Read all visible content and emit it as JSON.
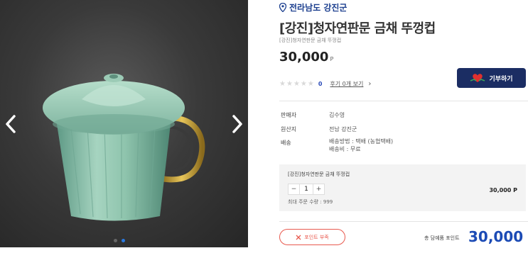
{
  "region": {
    "label": "전라남도 강진군",
    "icon": "location-pin-icon"
  },
  "product": {
    "title": "[강진]청자연판문 금채 뚜껑컵",
    "subtitle": "[강진]청자연판문 금채 뚜껑컵",
    "price": "30,000",
    "currency": "P"
  },
  "rating": {
    "stars": 0,
    "max_stars": 5,
    "count": "0",
    "review_link": "후기 0개 보기"
  },
  "donate_button": {
    "label": "기부하기",
    "icon": "heart-hand-icon"
  },
  "info": [
    {
      "label": "판매자",
      "value": "김수영"
    },
    {
      "label": "원산지",
      "value": "전남 강진군"
    },
    {
      "label": "배송",
      "value": "배송방법 : 택배 (농협택배)",
      "value2": "배송비 : 무료"
    }
  ],
  "option": {
    "name": "[강진]청자연판문 금채 뚜껑컵",
    "quantity": "1",
    "minus": "−",
    "plus": "+",
    "price": "30,000 P",
    "max_order": "최대 주문 수량 : 999"
  },
  "point_button": {
    "label": "포인트 부족",
    "icon": "close-icon"
  },
  "total": {
    "label": "총 담예품 포인트",
    "value": "30,000 P"
  },
  "gallery": {
    "slides": 2,
    "active_slide": 1
  },
  "colors": {
    "brand_navy": "#1b2d63",
    "accent_blue": "#1c4bb5",
    "warning_red": "#e85a4f",
    "celadon": "#8fc4ad"
  }
}
